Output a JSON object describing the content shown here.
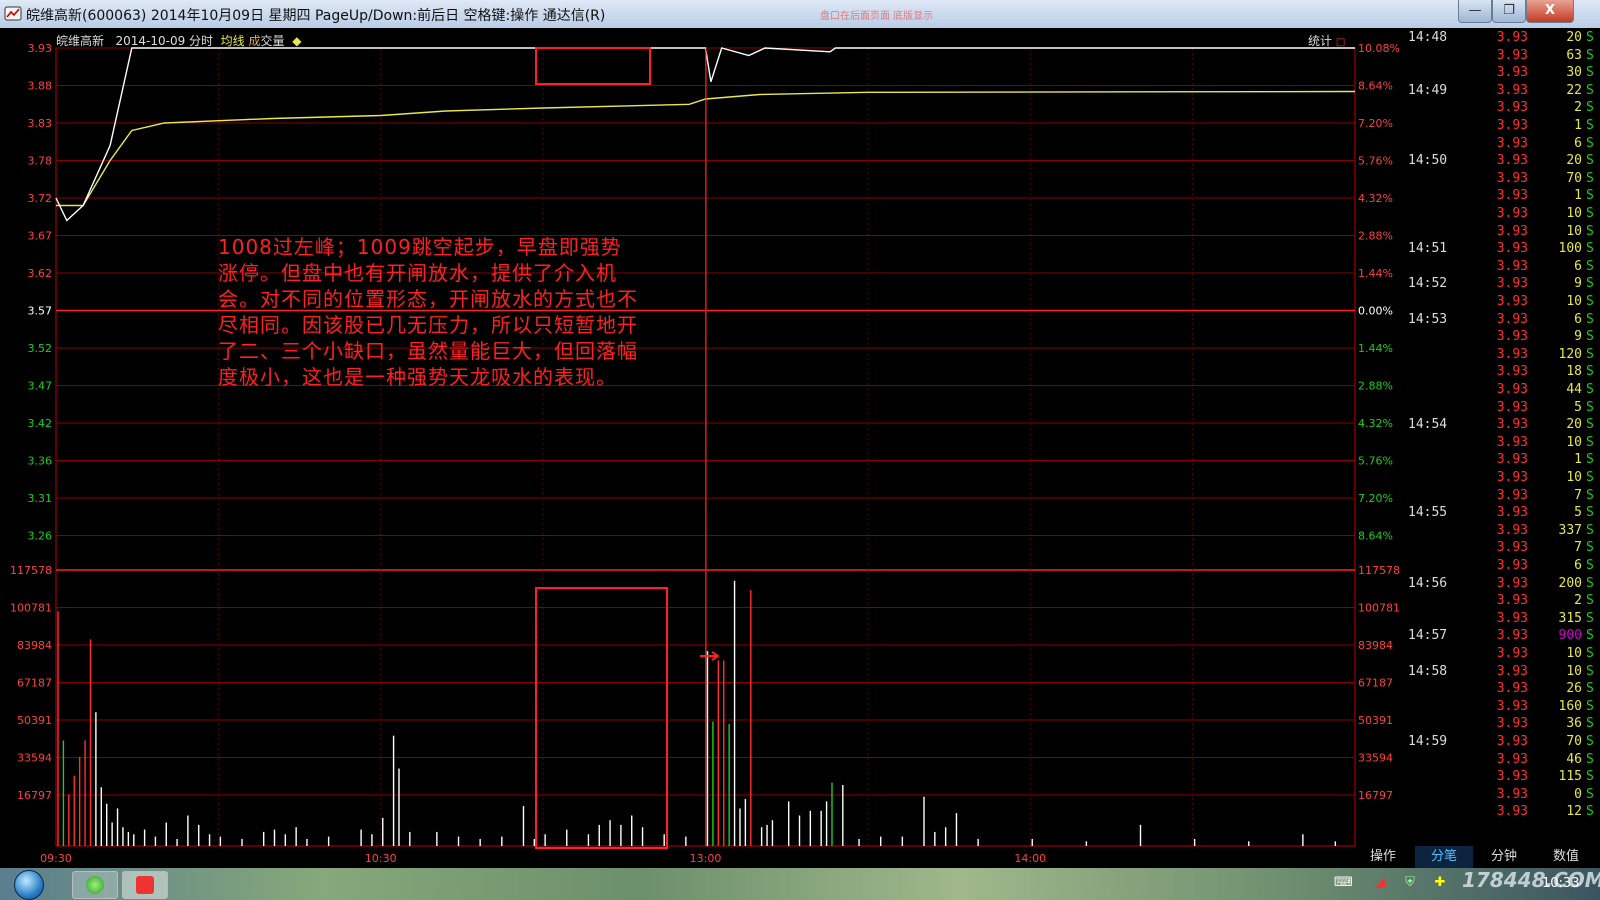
{
  "window": {
    "title": "皖维高新(600063) 2014年10月09日 星期四 PageUp/Down:前后日 空格键:操作 通达信(R)",
    "ghost_text": "盘口在后面页面 底版显示",
    "buttons": {
      "minimize": "—",
      "maximize": "❐",
      "close": "X"
    }
  },
  "chart_header": {
    "stock_name": "皖维高新",
    "date_mode": "2014-10-09 分时",
    "avg_line_label": "均线",
    "volume_label_cheng": "成",
    "volume_label_jiao": "交",
    "volume_label_liang": "量",
    "arrow_symbol": "◆",
    "stats_label": "统计"
  },
  "annotation": {
    "text": "1008过左峰；1009跳空起步，早盘即强势涨停。但盘中也有开闸放水，提供了介入机会。对不同的位置形态，开闸放水的方式也不尽相同。因该股已几无压力，所以只短暂地开了二、三个小缺口，虽然量能巨大，但回落幅度极小，这也是一种强势天龙吸水的表现。"
  },
  "chart_data": {
    "type": "line",
    "price_axis_left": [
      "3.93",
      "3.88",
      "3.83",
      "3.78",
      "3.72",
      "3.67",
      "3.62",
      "3.57",
      "3.52",
      "3.47",
      "3.42",
      "3.36",
      "3.31",
      "3.26"
    ],
    "pct_axis_right": [
      "10.08%",
      "8.64%",
      "7.20%",
      "5.76%",
      "4.32%",
      "2.88%",
      "1.44%",
      "0.00%",
      "1.44%",
      "2.88%",
      "4.32%",
      "5.76%",
      "7.20%",
      "8.64%"
    ],
    "volume_axis": [
      "117578",
      "100781",
      "83984",
      "67187",
      "50391",
      "33594",
      "16797"
    ],
    "time_ticks": [
      "09:30",
      "10:30",
      "13:00",
      "14:00"
    ],
    "prev_close": 3.57,
    "limit_up": 3.93,
    "price_series": [
      {
        "t": 0,
        "p": 3.73
      },
      {
        "t": 2,
        "p": 3.7
      },
      {
        "t": 5,
        "p": 3.72
      },
      {
        "t": 10,
        "p": 3.8
      },
      {
        "t": 14,
        "p": 3.93
      },
      {
        "t": 120,
        "p": 3.93
      },
      {
        "t": 121,
        "p": 3.885
      },
      {
        "t": 123,
        "p": 3.93
      },
      {
        "t": 128,
        "p": 3.92
      },
      {
        "t": 131,
        "p": 3.93
      },
      {
        "t": 143,
        "p": 3.925
      },
      {
        "t": 144,
        "p": 3.93
      },
      {
        "t": 240,
        "p": 3.93
      }
    ],
    "avg_series": [
      {
        "t": 0,
        "p": 3.72
      },
      {
        "t": 5,
        "p": 3.72
      },
      {
        "t": 10,
        "p": 3.78
      },
      {
        "t": 14,
        "p": 3.82
      },
      {
        "t": 20,
        "p": 3.83
      },
      {
        "t": 40,
        "p": 3.836
      },
      {
        "t": 60,
        "p": 3.84
      },
      {
        "t": 72,
        "p": 3.846
      },
      {
        "t": 90,
        "p": 3.85
      },
      {
        "t": 117,
        "p": 3.855
      },
      {
        "t": 120,
        "p": 3.862
      },
      {
        "t": 130,
        "p": 3.868
      },
      {
        "t": 150,
        "p": 3.871
      },
      {
        "t": 240,
        "p": 3.872
      }
    ],
    "volume_bars": [
      {
        "t": 0,
        "v": 100000,
        "c": "r"
      },
      {
        "t": 1,
        "v": 45000,
        "c": "g"
      },
      {
        "t": 2,
        "v": 22000,
        "c": "r"
      },
      {
        "t": 3,
        "v": 30000,
        "c": "r"
      },
      {
        "t": 4,
        "v": 38000,
        "c": "r"
      },
      {
        "t": 5,
        "v": 45000,
        "c": "r"
      },
      {
        "t": 6,
        "v": 88000,
        "c": "r"
      },
      {
        "t": 7,
        "v": 57000,
        "c": "w"
      },
      {
        "t": 8,
        "v": 25000,
        "c": "w"
      },
      {
        "t": 9,
        "v": 18000,
        "c": "w"
      },
      {
        "t": 10,
        "v": 10000,
        "c": "w"
      },
      {
        "t": 11,
        "v": 16000,
        "c": "w"
      },
      {
        "t": 12,
        "v": 8000,
        "c": "w"
      },
      {
        "t": 13,
        "v": 6000,
        "c": "w"
      },
      {
        "t": 14,
        "v": 5000,
        "c": "w"
      },
      {
        "t": 16,
        "v": 7000,
        "c": "w"
      },
      {
        "t": 18,
        "v": 4000,
        "c": "w"
      },
      {
        "t": 20,
        "v": 10000,
        "c": "w"
      },
      {
        "t": 22,
        "v": 3000,
        "c": "w"
      },
      {
        "t": 24,
        "v": 13000,
        "c": "w"
      },
      {
        "t": 26,
        "v": 9000,
        "c": "w"
      },
      {
        "t": 28,
        "v": 5000,
        "c": "w"
      },
      {
        "t": 30,
        "v": 4000,
        "c": "w"
      },
      {
        "t": 34,
        "v": 3000,
        "c": "w"
      },
      {
        "t": 38,
        "v": 6000,
        "c": "w"
      },
      {
        "t": 40,
        "v": 7000,
        "c": "w"
      },
      {
        "t": 42,
        "v": 5000,
        "c": "w"
      },
      {
        "t": 44,
        "v": 8000,
        "c": "w"
      },
      {
        "t": 46,
        "v": 3000,
        "c": "w"
      },
      {
        "t": 50,
        "v": 4000,
        "c": "w"
      },
      {
        "t": 56,
        "v": 7000,
        "c": "w"
      },
      {
        "t": 58,
        "v": 5000,
        "c": "w"
      },
      {
        "t": 60,
        "v": 12000,
        "c": "w"
      },
      {
        "t": 62,
        "v": 47000,
        "c": "w"
      },
      {
        "t": 63,
        "v": 33000,
        "c": "w"
      },
      {
        "t": 65,
        "v": 6000,
        "c": "w"
      },
      {
        "t": 70,
        "v": 6000,
        "c": "w"
      },
      {
        "t": 74,
        "v": 4000,
        "c": "w"
      },
      {
        "t": 78,
        "v": 3000,
        "c": "w"
      },
      {
        "t": 82,
        "v": 4000,
        "c": "w"
      },
      {
        "t": 86,
        "v": 17000,
        "c": "w"
      },
      {
        "t": 88,
        "v": 3000,
        "c": "w"
      },
      {
        "t": 90,
        "v": 5000,
        "c": "w"
      },
      {
        "t": 94,
        "v": 7000,
        "c": "w"
      },
      {
        "t": 98,
        "v": 5000,
        "c": "w"
      },
      {
        "t": 100,
        "v": 9000,
        "c": "w"
      },
      {
        "t": 102,
        "v": 11000,
        "c": "w"
      },
      {
        "t": 104,
        "v": 9000,
        "c": "w"
      },
      {
        "t": 106,
        "v": 13000,
        "c": "w"
      },
      {
        "t": 108,
        "v": 8000,
        "c": "w"
      },
      {
        "t": 112,
        "v": 5000,
        "c": "w"
      },
      {
        "t": 116,
        "v": 4000,
        "c": "w"
      },
      {
        "t": 120,
        "v": 83000,
        "c": "w"
      },
      {
        "t": 121,
        "v": 53000,
        "c": "g"
      },
      {
        "t": 122,
        "v": 79000,
        "c": "r"
      },
      {
        "t": 123,
        "v": 79000,
        "c": "r"
      },
      {
        "t": 124,
        "v": 52000,
        "c": "g"
      },
      {
        "t": 125,
        "v": 113000,
        "c": "w"
      },
      {
        "t": 126,
        "v": 16000,
        "c": "w"
      },
      {
        "t": 127,
        "v": 20000,
        "c": "w"
      },
      {
        "t": 128,
        "v": 109000,
        "c": "r"
      },
      {
        "t": 130,
        "v": 8000,
        "c": "w"
      },
      {
        "t": 131,
        "v": 9000,
        "c": "w"
      },
      {
        "t": 132,
        "v": 11000,
        "c": "w"
      },
      {
        "t": 135,
        "v": 19000,
        "c": "w"
      },
      {
        "t": 137,
        "v": 13000,
        "c": "w"
      },
      {
        "t": 139,
        "v": 15000,
        "c": "w"
      },
      {
        "t": 141,
        "v": 15000,
        "c": "w"
      },
      {
        "t": 142,
        "v": 19000,
        "c": "w"
      },
      {
        "t": 143,
        "v": 27000,
        "c": "g"
      },
      {
        "t": 145,
        "v": 26000,
        "c": "w"
      },
      {
        "t": 148,
        "v": 3000,
        "c": "w"
      },
      {
        "t": 152,
        "v": 4000,
        "c": "w"
      },
      {
        "t": 156,
        "v": 4000,
        "c": "w"
      },
      {
        "t": 160,
        "v": 21000,
        "c": "w"
      },
      {
        "t": 162,
        "v": 6000,
        "c": "w"
      },
      {
        "t": 164,
        "v": 8000,
        "c": "w"
      },
      {
        "t": 166,
        "v": 14000,
        "c": "w"
      },
      {
        "t": 170,
        "v": 3000,
        "c": "w"
      },
      {
        "t": 180,
        "v": 3000,
        "c": "w"
      },
      {
        "t": 190,
        "v": 2000,
        "c": "w"
      },
      {
        "t": 200,
        "v": 9000,
        "c": "w"
      },
      {
        "t": 210,
        "v": 3000,
        "c": "w"
      },
      {
        "t": 220,
        "v": 2000,
        "c": "w"
      },
      {
        "t": 230,
        "v": 5000,
        "c": "w"
      },
      {
        "t": 236,
        "v": 2000,
        "c": "w"
      }
    ],
    "volume_max": 117578,
    "colors": {
      "up": "#ff3030",
      "down": "#19d019",
      "flat": "#ffffff",
      "price_line": "#ffffff",
      "avg_line": "#e8e84e",
      "grid": "#c00000",
      "highlight_box": "#ff2020"
    }
  },
  "trades": [
    {
      "time": "14:48",
      "price": "3.93",
      "vol": "20",
      "side": "S"
    },
    {
      "time": "",
      "price": "3.93",
      "vol": "63",
      "side": "S"
    },
    {
      "time": "",
      "price": "3.93",
      "vol": "30",
      "side": "S"
    },
    {
      "time": "14:49",
      "price": "3.93",
      "vol": "22",
      "side": "S"
    },
    {
      "time": "",
      "price": "3.93",
      "vol": "2",
      "side": "S"
    },
    {
      "time": "",
      "price": "3.93",
      "vol": "1",
      "side": "S"
    },
    {
      "time": "",
      "price": "3.93",
      "vol": "6",
      "side": "S"
    },
    {
      "time": "14:50",
      "price": "3.93",
      "vol": "20",
      "side": "S"
    },
    {
      "time": "",
      "price": "3.93",
      "vol": "70",
      "side": "S"
    },
    {
      "time": "",
      "price": "3.93",
      "vol": "1",
      "side": "S"
    },
    {
      "time": "",
      "price": "3.93",
      "vol": "10",
      "side": "S"
    },
    {
      "time": "",
      "price": "3.93",
      "vol": "10",
      "side": "S"
    },
    {
      "time": "14:51",
      "price": "3.93",
      "vol": "100",
      "side": "S"
    },
    {
      "time": "",
      "price": "3.93",
      "vol": "6",
      "side": "S"
    },
    {
      "time": "14:52",
      "price": "3.93",
      "vol": "9",
      "side": "S"
    },
    {
      "time": "",
      "price": "3.93",
      "vol": "10",
      "side": "S"
    },
    {
      "time": "14:53",
      "price": "3.93",
      "vol": "6",
      "side": "S"
    },
    {
      "time": "",
      "price": "3.93",
      "vol": "9",
      "side": "S"
    },
    {
      "time": "",
      "price": "3.93",
      "vol": "120",
      "side": "S"
    },
    {
      "time": "",
      "price": "3.93",
      "vol": "18",
      "side": "S"
    },
    {
      "time": "",
      "price": "3.93",
      "vol": "44",
      "side": "S"
    },
    {
      "time": "",
      "price": "3.93",
      "vol": "5",
      "side": "S"
    },
    {
      "time": "14:54",
      "price": "3.93",
      "vol": "20",
      "side": "S"
    },
    {
      "time": "",
      "price": "3.93",
      "vol": "10",
      "side": "S"
    },
    {
      "time": "",
      "price": "3.93",
      "vol": "1",
      "side": "S"
    },
    {
      "time": "",
      "price": "3.93",
      "vol": "10",
      "side": "S"
    },
    {
      "time": "",
      "price": "3.93",
      "vol": "7",
      "side": "S"
    },
    {
      "time": "14:55",
      "price": "3.93",
      "vol": "5",
      "side": "S"
    },
    {
      "time": "",
      "price": "3.93",
      "vol": "337",
      "side": "S"
    },
    {
      "time": "",
      "price": "3.93",
      "vol": "7",
      "side": "S"
    },
    {
      "time": "",
      "price": "3.93",
      "vol": "6",
      "side": "S"
    },
    {
      "time": "14:56",
      "price": "3.93",
      "vol": "200",
      "side": "S"
    },
    {
      "time": "",
      "price": "3.93",
      "vol": "2",
      "side": "S"
    },
    {
      "time": "",
      "price": "3.93",
      "vol": "315",
      "side": "S"
    },
    {
      "time": "14:57",
      "price": "3.93",
      "vol": "900",
      "side": "S",
      "big": true
    },
    {
      "time": "",
      "price": "3.93",
      "vol": "10",
      "side": "S"
    },
    {
      "time": "14:58",
      "price": "3.93",
      "vol": "10",
      "side": "S"
    },
    {
      "time": "",
      "price": "3.93",
      "vol": "26",
      "side": "S"
    },
    {
      "time": "",
      "price": "3.93",
      "vol": "160",
      "side": "S"
    },
    {
      "time": "",
      "price": "3.93",
      "vol": "36",
      "side": "S"
    },
    {
      "time": "14:59",
      "price": "3.93",
      "vol": "70",
      "side": "S"
    },
    {
      "time": "",
      "price": "3.93",
      "vol": "46",
      "side": "S"
    },
    {
      "time": "",
      "price": "3.93",
      "vol": "115",
      "side": "S"
    },
    {
      "time": "",
      "price": "3.93",
      "vol": "0",
      "side": "S"
    },
    {
      "time": "",
      "price": "3.93",
      "vol": "12",
      "side": "S"
    }
  ],
  "bottom_tabs": [
    "操作",
    "分笔",
    "分钟",
    "数值"
  ],
  "bottom_tab_active": 1,
  "taskbar": {
    "watermark": "178448.COM",
    "clock": "10:33"
  }
}
